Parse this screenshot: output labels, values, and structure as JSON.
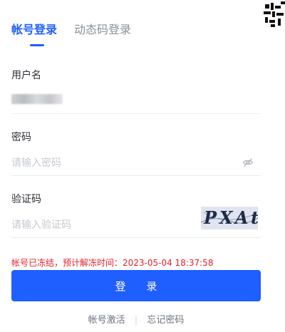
{
  "tabs": [
    {
      "label": "帐号登录",
      "active": true
    },
    {
      "label": "动态码登录",
      "active": false
    }
  ],
  "username": {
    "label": "用户名",
    "value": "········"
  },
  "password": {
    "label": "密码",
    "placeholder": "请输入密码",
    "toggle_icon": "eye-off-icon"
  },
  "captcha_field": {
    "label": "验证码",
    "placeholder": "请输入验证码",
    "image_text": "PXAt"
  },
  "error_message": "帐号已冻结，预计解冻时间：2023-05-04 18:37:58",
  "login_button": "登 录",
  "links": {
    "activate": "帐号激活",
    "separator": "|",
    "forgot": "忘记密码"
  },
  "colors": {
    "accent": "#1f5eff",
    "error": "#e5202b"
  }
}
